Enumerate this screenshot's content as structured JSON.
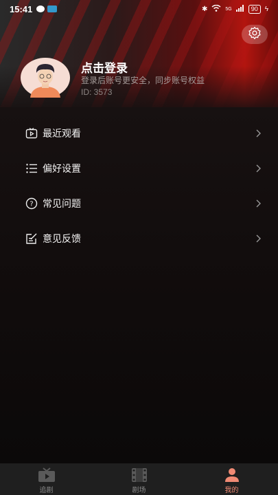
{
  "status_bar": {
    "time": "15:41",
    "network": "5G",
    "battery": "90"
  },
  "profile": {
    "title": "点击登录",
    "subtitle": "登录后账号更安全，同步账号权益",
    "user_id": "ID: 3573"
  },
  "menu": [
    {
      "label": "最近观看",
      "icon": "tv-play-icon"
    },
    {
      "label": "偏好设置",
      "icon": "list-icon"
    },
    {
      "label": "常见问题",
      "icon": "question-circle-icon"
    },
    {
      "label": "意见反馈",
      "icon": "edit-note-icon"
    }
  ],
  "tabs": [
    {
      "label": "追剧",
      "icon": "tv-icon",
      "active": false
    },
    {
      "label": "剧场",
      "icon": "film-icon",
      "active": false
    },
    {
      "label": "我的",
      "icon": "person-icon",
      "active": true
    }
  ],
  "colors": {
    "accent": "#f08a74",
    "header_red": "#b3150f",
    "tab_bg": "#1f1f1f"
  }
}
